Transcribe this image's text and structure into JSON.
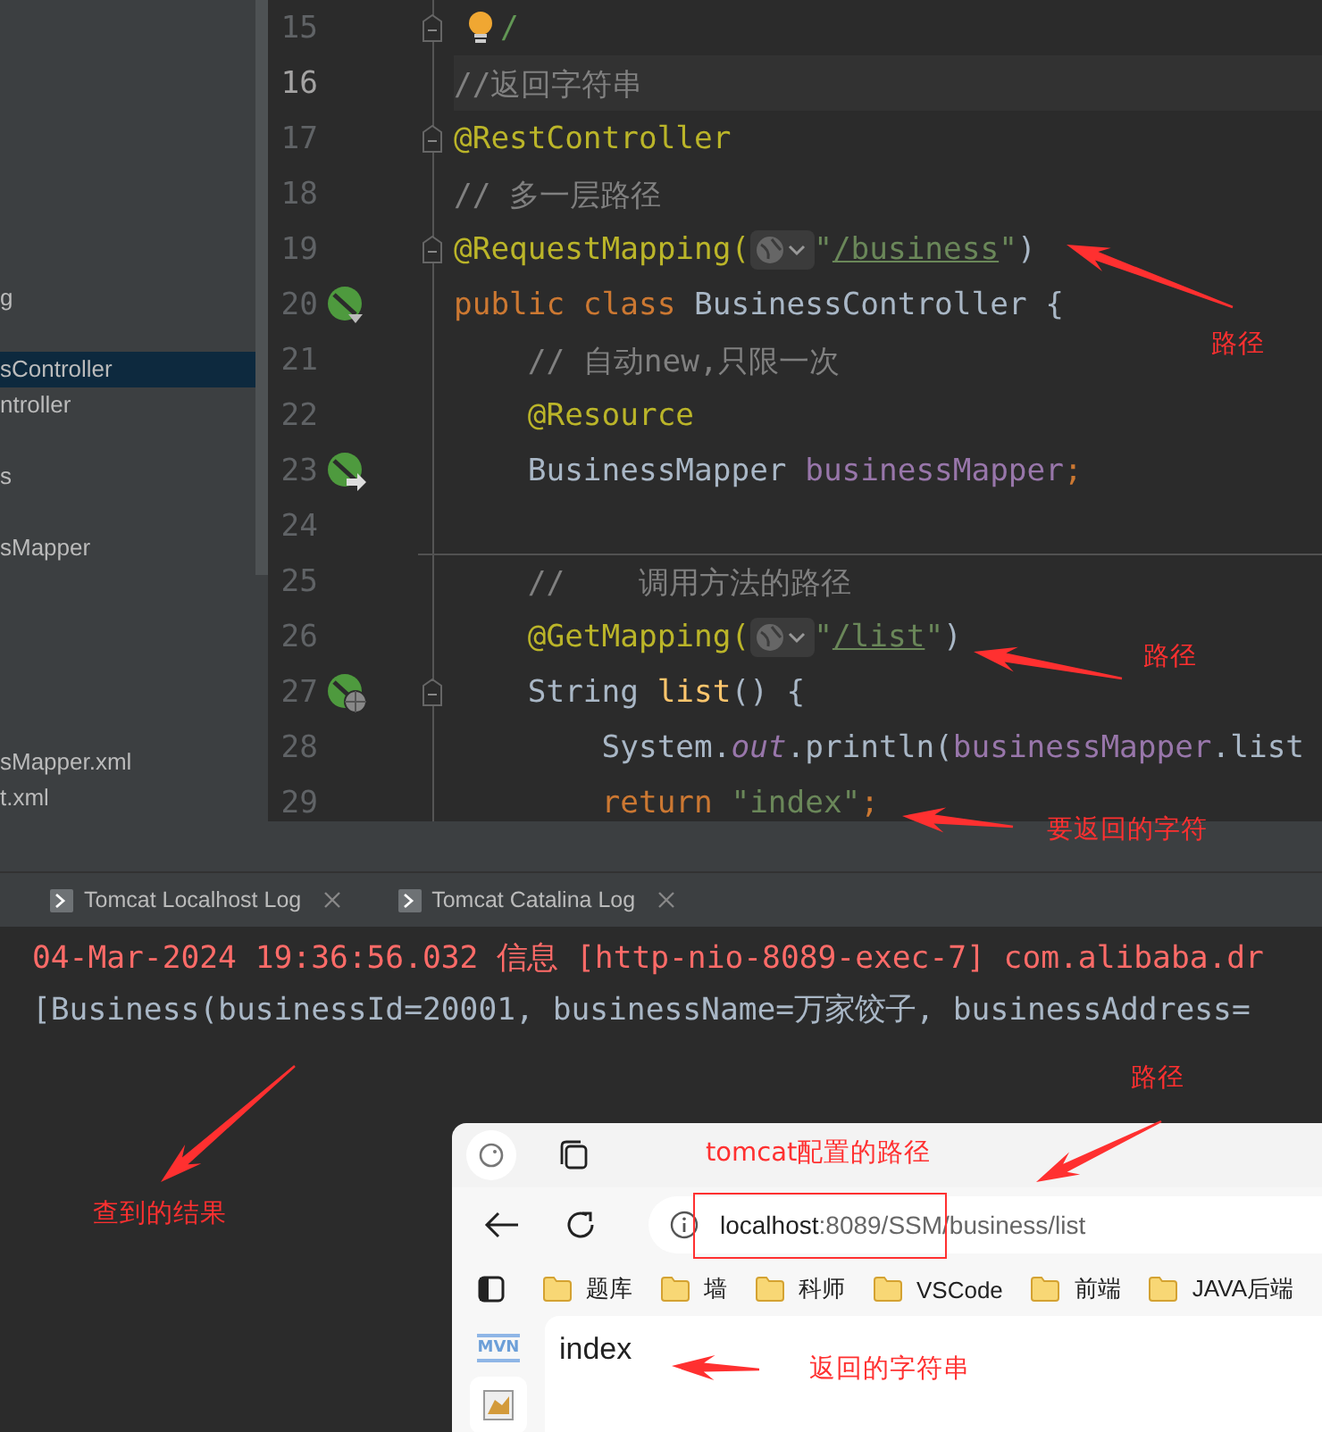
{
  "project_tree": {
    "items": [
      {
        "label": "g",
        "selected": false
      },
      {
        "label": "sController",
        "selected": true
      },
      {
        "label": "ntroller",
        "selected": false
      },
      {
        "label": "s",
        "selected": false
      },
      {
        "label": "sMapper",
        "selected": false
      },
      {
        "label": "sMapper.xml",
        "selected": false
      },
      {
        "label": "t.xml",
        "selected": false
      }
    ]
  },
  "editor": {
    "lines": [
      {
        "number": "15",
        "current": false,
        "fold": true,
        "separator": false,
        "segments": [
          {
            "kind": "bulb"
          },
          {
            "kind": "doc",
            "text": "/"
          }
        ]
      },
      {
        "number": "16",
        "current": true,
        "fold": false,
        "separator": false,
        "segments": [
          {
            "kind": "comment",
            "text": "//返回字符串"
          }
        ]
      },
      {
        "number": "17",
        "current": false,
        "fold": true,
        "separator": false,
        "segments": [
          {
            "kind": "annotation",
            "text": "@RestController"
          }
        ]
      },
      {
        "number": "18",
        "current": false,
        "fold": false,
        "separator": false,
        "segments": [
          {
            "kind": "comment",
            "text": "// 多一层路径"
          }
        ]
      },
      {
        "number": "19",
        "current": false,
        "fold": true,
        "separator": false,
        "segments": [
          {
            "kind": "annotation",
            "text": "@RequestMapping("
          },
          {
            "kind": "hint"
          },
          {
            "kind": "string",
            "text": "\""
          },
          {
            "kind": "link",
            "text": "/business"
          },
          {
            "kind": "string",
            "text": "\""
          },
          {
            "kind": "plain",
            "text": ")"
          }
        ]
      },
      {
        "number": "20",
        "current": false,
        "fold": false,
        "separator": false,
        "kind": "bean-down",
        "segments": [
          {
            "kind": "keyword",
            "text": "public class "
          },
          {
            "kind": "plain",
            "text": "BusinessController {"
          }
        ],
        "children": [
          {
            "number": "21",
            "current": false,
            "fold": false,
            "separator": false,
            "segments": [
              {
                "kind": "comment",
                "text": "// 自动new,只限一次"
              }
            ]
          },
          {
            "number": "22",
            "current": false,
            "fold": false,
            "separator": false,
            "segments": [
              {
                "kind": "annotation",
                "text": "@Resource"
              }
            ]
          },
          {
            "number": "23",
            "current": false,
            "fold": false,
            "separator": false,
            "kind": "bean-right",
            "segments": [
              {
                "kind": "plain",
                "text": "BusinessMapper "
              },
              {
                "kind": "field",
                "text": "businessMapper"
              },
              {
                "kind": "keyword",
                "text": ";"
              }
            ]
          },
          {
            "number": "24",
            "current": false,
            "fold": false,
            "separator": false
          },
          {
            "number": "25",
            "current": false,
            "fold": false,
            "separator": true,
            "segments": [
              {
                "kind": "comment",
                "text": "//    调用方法的路径"
              }
            ]
          },
          {
            "number": "26",
            "current": false,
            "fold": false,
            "separator": false,
            "segments": [
              {
                "kind": "annotation",
                "text": "@GetMapping("
              },
              {
                "kind": "hint"
              },
              {
                "kind": "string",
                "text": "\""
              },
              {
                "kind": "link",
                "text": "/list"
              },
              {
                "kind": "string",
                "text": "\""
              },
              {
                "kind": "plain",
                "text": ")"
              }
            ]
          },
          {
            "number": "27",
            "current": false,
            "fold": true,
            "separator": false,
            "kind": "bean-web",
            "segments": [
              {
                "kind": "plain",
                "text": "String "
              },
              {
                "kind": "method",
                "text": "list"
              },
              {
                "kind": "plain",
                "text": "() {"
              }
            ],
            "children": [
              {
                "number": "28",
                "current": false,
                "fold": false,
                "separator": false,
                "segments": [
                  {
                    "kind": "plain",
                    "text": "System."
                  },
                  {
                    "kind": "static",
                    "text": "out"
                  },
                  {
                    "kind": "plain",
                    "text": ".println("
                  },
                  {
                    "kind": "field",
                    "text": "businessMapper"
                  },
                  {
                    "kind": "plain",
                    "text": ".list"
                  }
                ]
              },
              {
                "number": "29",
                "current": false,
                "fold": false,
                "separator": false,
                "segments": [
                  {
                    "kind": "keyword",
                    "text": "return "
                  },
                  {
                    "kind": "string",
                    "text": "\"index\""
                  },
                  {
                    "kind": "keyword",
                    "text": ";"
                  }
                ]
              }
            ]
          }
        ]
      }
    ]
  },
  "run_panel": {
    "tabs": [
      {
        "label": "Tomcat Localhost Log",
        "selected": false
      },
      {
        "label": "Tomcat Catalina Log",
        "selected": false
      }
    ],
    "console": [
      {
        "kind": "error",
        "text": "04-Mar-2024 19:36:56.032 信息 [http-nio-8089-exec-7] com.alibaba.dr"
      },
      {
        "kind": "output",
        "text": "[Business(businessId=20001, businessName=万家饺子, businessAddress="
      }
    ]
  },
  "browser": {
    "address": {
      "host": "localhost",
      "path": ":8089/SSM/business/list"
    },
    "bookmarks": [
      {
        "label": "题库"
      },
      {
        "label": "墙"
      },
      {
        "label": "科师"
      },
      {
        "label": "VSCode"
      },
      {
        "label": "前端"
      },
      {
        "label": "JAVA后端"
      }
    ],
    "side_app_label": "MVN",
    "page_text": "index"
  },
  "annotations": [
    {
      "text": "路径"
    },
    {
      "text": "路径"
    },
    {
      "text": "要返回的字符"
    },
    {
      "text": "路径"
    },
    {
      "text": "tomcat配置的路径"
    },
    {
      "text": "查到的结果"
    },
    {
      "text": "返回的字符串"
    }
  ]
}
